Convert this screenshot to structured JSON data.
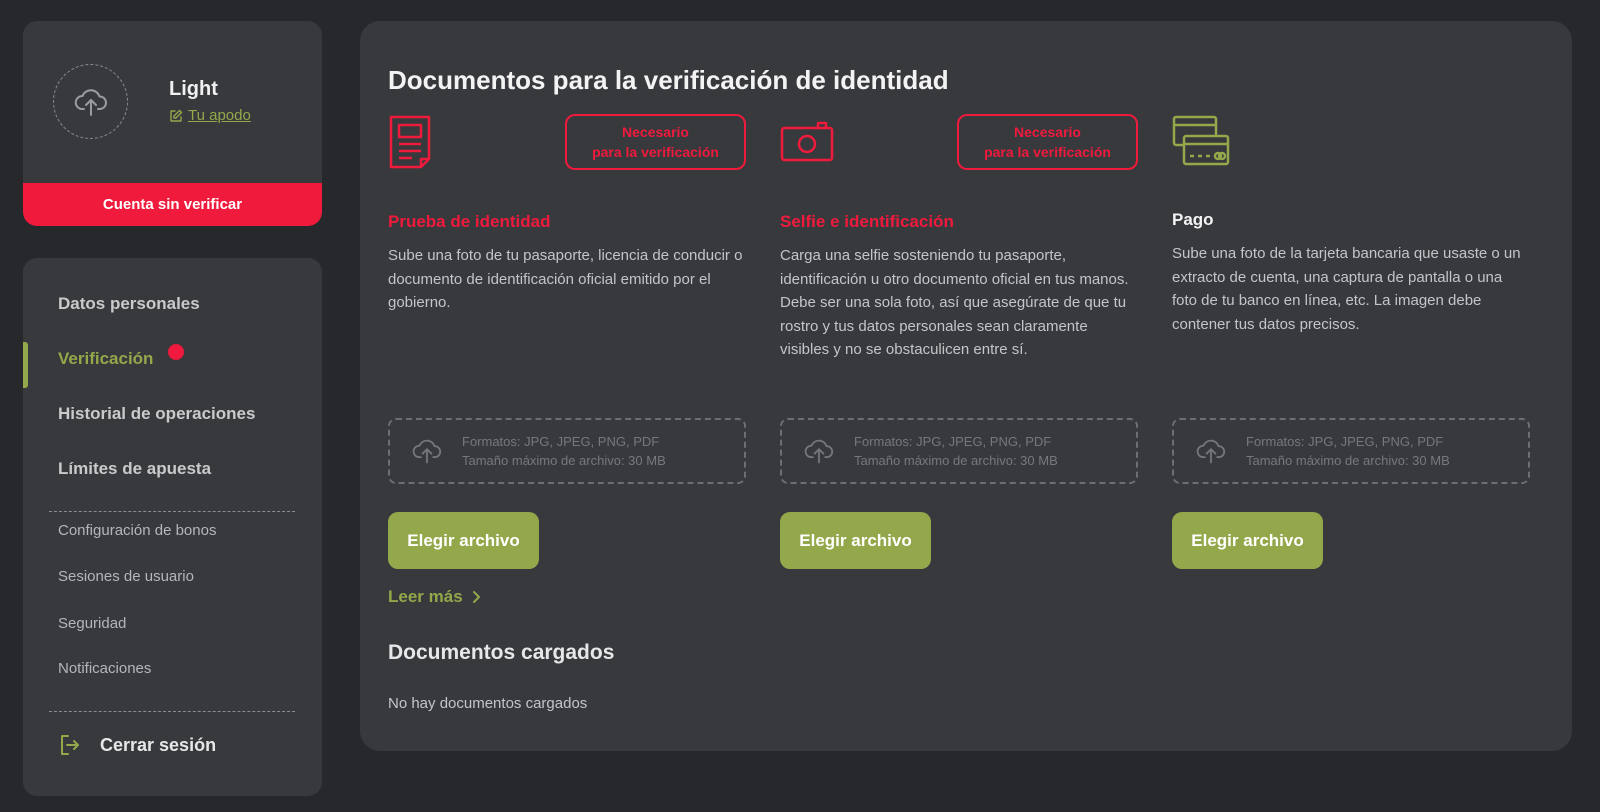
{
  "profile": {
    "nickname": "Light",
    "edit_nickname_label": "Tu apodo",
    "status_bar": "Cuenta sin verificar"
  },
  "menu": {
    "items": [
      {
        "label": "Datos personales"
      },
      {
        "label": "Verificación",
        "active": true,
        "has_notification": true
      },
      {
        "label": "Historial de operaciones"
      },
      {
        "label": "Límites de apuesta"
      }
    ],
    "subitems": [
      {
        "label": "Configuración de bonos"
      },
      {
        "label": "Sesiones de usuario"
      },
      {
        "label": "Seguridad"
      },
      {
        "label": "Notificaciones"
      }
    ],
    "logout_label": "Cerrar sesión"
  },
  "main": {
    "title": "Documentos para la verificación de identidad",
    "documents": [
      {
        "icon": "document-icon",
        "badge_line1": "Necesario",
        "badge_line2": "para la verificación",
        "title": "Prueba de identidad",
        "description": "Sube una foto de tu pasaporte, licencia de conducir o documento de identificación oficial emitido por el gobierno.",
        "upload_formats": "Formatos: JPG, JPEG, PNG, PDF",
        "upload_max_size": "Tamaño máximo de archivo: 30 MB",
        "button_label": "Elegir archivo"
      },
      {
        "icon": "camera-icon",
        "badge_line1": "Necesario",
        "badge_line2": "para la verificación",
        "title": "Selfie e identificación",
        "description": "Carga una selfie sosteniendo tu pasaporte, identificación u otro documento oficial en tus manos. Debe ser una sola foto, así que asegúrate de que tu rostro y tus datos personales sean claramente visibles y no se obstaculicen entre sí.",
        "upload_formats": "Formatos: JPG, JPEG, PNG, PDF",
        "upload_max_size": "Tamaño máximo de archivo: 30 MB",
        "button_label": "Elegir archivo"
      },
      {
        "icon": "credit-card-icon",
        "title": "Pago",
        "description": "Sube una foto de la tarjeta bancaria que usaste o un extracto de cuenta, una captura de pantalla o una foto de tu banco en línea, etc. La imagen debe contener tus datos precisos.",
        "upload_formats": "Formatos: JPG, JPEG, PNG, PDF",
        "upload_max_size": "Tamaño máximo de archivo: 30 MB",
        "button_label": "Elegir archivo"
      }
    ],
    "read_more_label": "Leer más",
    "uploaded_title": "Documentos cargados",
    "uploaded_empty": "No hay documentos cargados"
  },
  "colors": {
    "accent_green": "#93a84a",
    "accent_red": "#ef1a3c",
    "panel_bg": "#37393d",
    "page_bg": "#26282c"
  }
}
